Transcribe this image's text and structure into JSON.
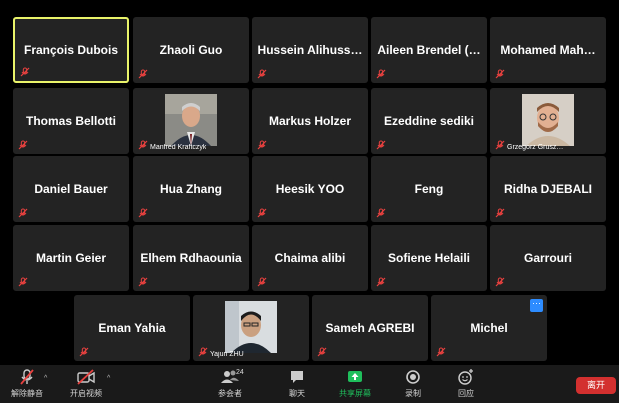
{
  "participants": [
    {
      "name": "François Dubois",
      "active": true
    },
    {
      "name": "Zhaoli Guo"
    },
    {
      "name": "Hussein Alihuss…"
    },
    {
      "name": "Aileen Brendel (…"
    },
    {
      "name": "Mohamed Mah…"
    },
    {
      "name": "Thomas Bellotti"
    },
    {
      "name": "Manfred Kraftczyk",
      "video": true
    },
    {
      "name": "Markus Holzer"
    },
    {
      "name": "Ezeddine sediki"
    },
    {
      "name": "Grzegorz Grusz…",
      "video": true
    },
    {
      "name": "Daniel Bauer"
    },
    {
      "name": "Hua Zhang"
    },
    {
      "name": "Heesik YOO"
    },
    {
      "name": "Feng"
    },
    {
      "name": "Ridha DJEBALI"
    },
    {
      "name": "Martin Geier"
    },
    {
      "name": "Elhem Rdhaounia"
    },
    {
      "name": "Chaima alibi"
    },
    {
      "name": "Sofiene Helaili"
    },
    {
      "name": "Garrouri"
    },
    {
      "name": "Eman Yahia"
    },
    {
      "name": "Yajun ZHU",
      "video": true
    },
    {
      "name": "Sameh AGREBI"
    },
    {
      "name": "Michel",
      "menu": true
    }
  ],
  "tile_menu_label": "···",
  "toolbar": {
    "unmute": "解除静音",
    "start_video": "开启视频",
    "participants": "参会者",
    "participant_count": "24",
    "chat": "聊天",
    "share": "共享屏幕",
    "record": "录制",
    "reactions": "回应",
    "leave": "离开"
  },
  "colors": {
    "active_border": "#e9f36a",
    "share_green": "#1fbf5c",
    "leave_red": "#d3302f",
    "muted_red": "#e8413f"
  }
}
